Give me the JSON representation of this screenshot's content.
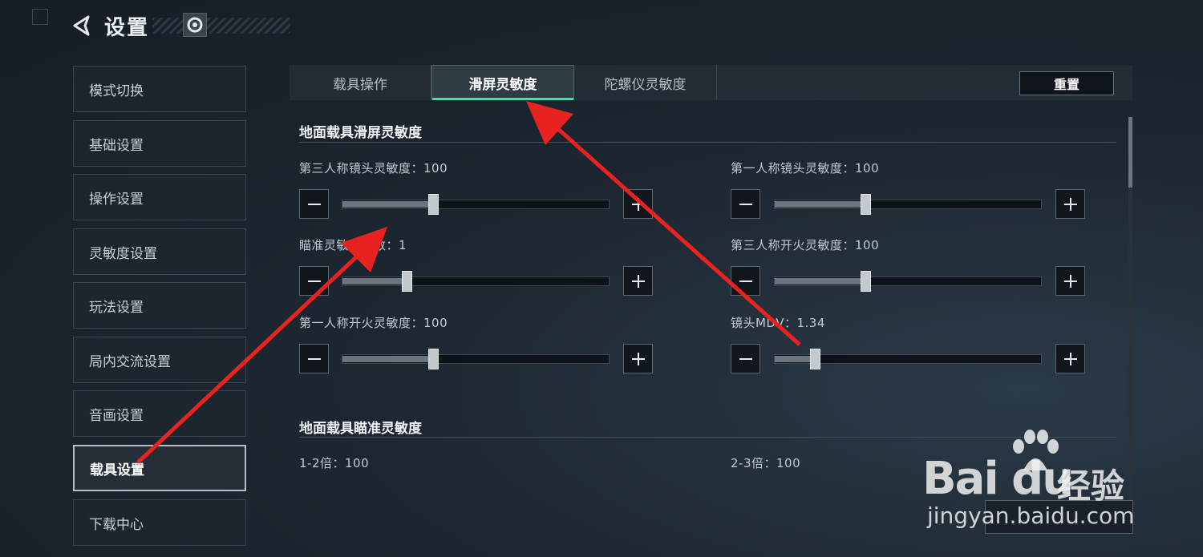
{
  "header": {
    "title": "设置",
    "back_icon": "back-arrow-icon",
    "badge_icon": "profile-badge-icon"
  },
  "sidebar": {
    "items": [
      {
        "label": "模式切换",
        "active": false
      },
      {
        "label": "基础设置",
        "active": false
      },
      {
        "label": "操作设置",
        "active": false
      },
      {
        "label": "灵敏度设置",
        "active": false
      },
      {
        "label": "玩法设置",
        "active": false
      },
      {
        "label": "局内交流设置",
        "active": false
      },
      {
        "label": "音画设置",
        "active": false
      },
      {
        "label": "载具设置",
        "active": true
      },
      {
        "label": "下载中心",
        "active": false
      }
    ]
  },
  "tabs": [
    {
      "label": "载具操作",
      "active": false
    },
    {
      "label": "滑屏灵敏度",
      "active": true
    },
    {
      "label": "陀螺仪灵敏度",
      "active": false
    }
  ],
  "reset_label": "重置",
  "sections": {
    "ground_vehicle_swipe": {
      "title": "地面载具滑屏灵敏度",
      "settings": [
        {
          "label": "第三人称镜头灵敏度：100",
          "level": 0.34
        },
        {
          "label": "第一人称镜头灵敏度：100",
          "level": 0.34
        },
        {
          "label": "瞄准灵敏度系数：1",
          "level": 0.24
        },
        {
          "label": "第三人称开火灵敏度：100",
          "level": 0.34
        },
        {
          "label": "第一人称开火灵敏度：100",
          "level": 0.34
        },
        {
          "label": "镜头MDV：1.34",
          "level": 0.15
        }
      ]
    },
    "ground_vehicle_aim": {
      "title": "地面载具瞄准灵敏度",
      "settings": [
        {
          "label": "1-2倍：100"
        },
        {
          "label": "2-3倍：100"
        }
      ]
    }
  },
  "watermark": {
    "brand": "Bai du",
    "suffix": "经验",
    "url": "jingyan.baidu.com"
  },
  "colors": {
    "accent": "#5fd0a8",
    "annotation_arrow": "#e8231f"
  }
}
